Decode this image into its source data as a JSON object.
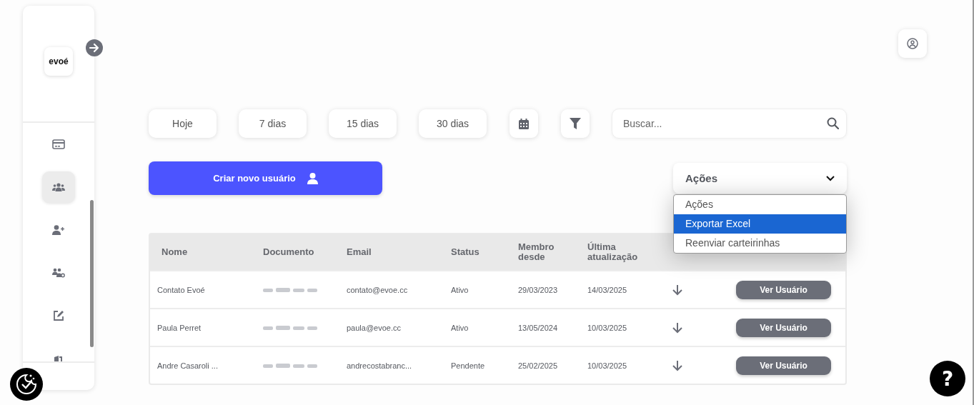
{
  "sidebar": {
    "logo": "evoé",
    "items": [
      {
        "kind": "card",
        "selected": false
      },
      {
        "kind": "group",
        "selected": true
      },
      {
        "kind": "user-plus",
        "selected": false
      },
      {
        "kind": "group-gear",
        "selected": false
      },
      {
        "kind": "edit",
        "selected": false
      },
      {
        "kind": "door",
        "selected": false
      }
    ]
  },
  "period_buttons": [
    "Hoje",
    "7 dias",
    "15 dias",
    "30 dias"
  ],
  "search": {
    "placeholder": "Buscar..."
  },
  "create_button": "Criar novo usuário",
  "actions": {
    "value": "Ações",
    "expanded": true,
    "options": [
      {
        "label": "Ações",
        "highlighted": false
      },
      {
        "label": "Exportar Excel",
        "highlighted": true
      },
      {
        "label": "Reenviar carteirinhas",
        "highlighted": false
      }
    ]
  },
  "table": {
    "columns": [
      "Nome",
      "Documento",
      "Email",
      "Status",
      "Membro desde",
      "Última atualização"
    ],
    "rows": [
      {
        "name": "Contato Evoé",
        "email": "contato@evoe.cc",
        "status": "Ativo",
        "member_since": "29/03/2023",
        "updated": "14/03/2025",
        "button": "Ver Usuário"
      },
      {
        "name": "Paula Perret",
        "email": "paula@evoe.cc",
        "status": "Ativo",
        "member_since": "13/05/2024",
        "updated": "10/03/2025",
        "button": "Ver Usuário"
      },
      {
        "name": "Andre Casaroli ...",
        "email": "andrecostabranc...",
        "status": "Pendente",
        "member_since": "25/02/2025",
        "updated": "10/03/2025",
        "button": "Ver Usuário"
      }
    ]
  },
  "help_button": "?"
}
